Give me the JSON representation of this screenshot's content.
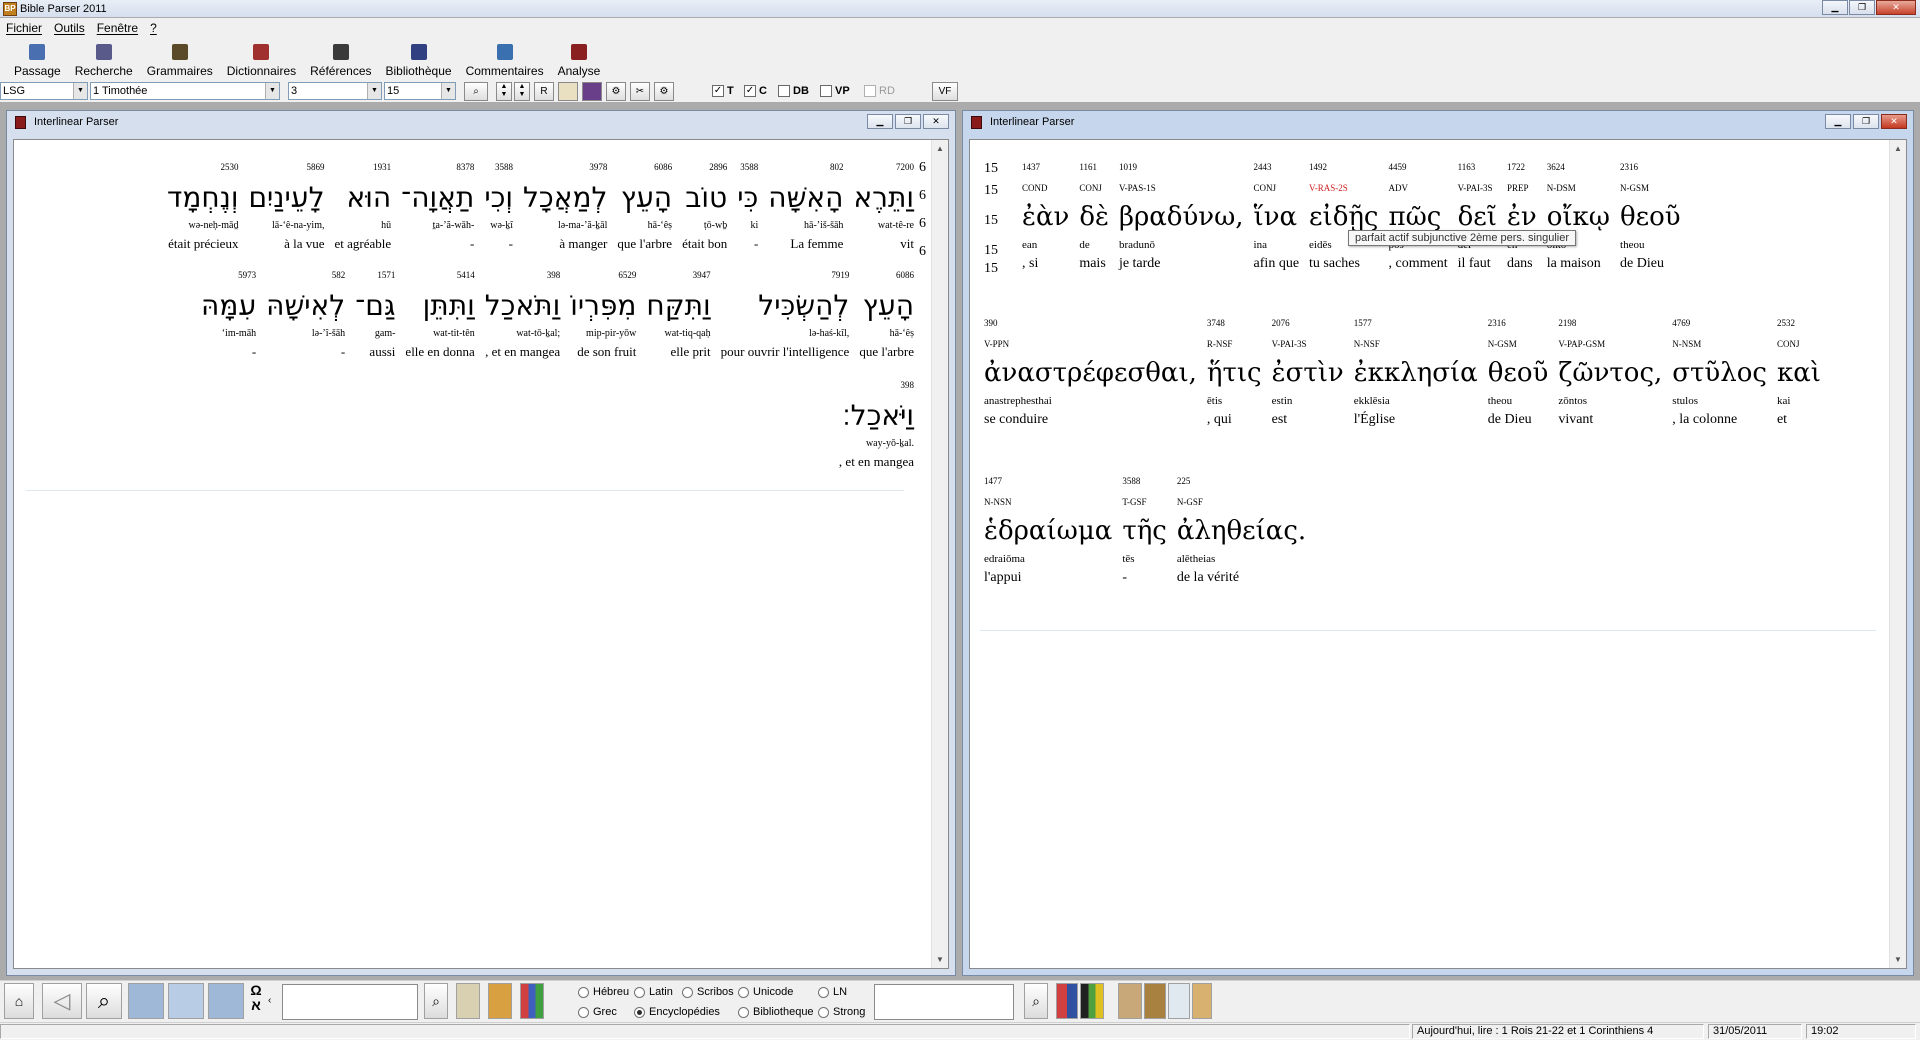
{
  "app": {
    "title": "Bible Parser 2011",
    "icon": "BP"
  },
  "menu": [
    "Fichier",
    "Outils",
    "Fenêtre",
    "?"
  ],
  "toolbar": [
    {
      "label": "Passage",
      "icon": "passage-icon",
      "color": "#4a6fb0"
    },
    {
      "label": "Recherche",
      "icon": "search-icon",
      "color": "#5a5a8a"
    },
    {
      "label": "Grammaires",
      "icon": "grammar-books-icon",
      "color": "#5a4a2a"
    },
    {
      "label": "Dictionnaires",
      "icon": "dictionary-icon",
      "color": "#a03030"
    },
    {
      "label": "Références",
      "icon": "references-icon",
      "color": "#3a3a3a"
    },
    {
      "label": "Bibliothèque",
      "icon": "library-icon",
      "color": "#304080"
    },
    {
      "label": "Commentaires",
      "icon": "comments-icon",
      "color": "#3a70b0"
    },
    {
      "label": "Analyse",
      "icon": "analysis-icon",
      "color": "#8a2020"
    }
  ],
  "selectors": {
    "version": "LSG",
    "book": "1 Timothée",
    "chapter": "3",
    "verse": "15"
  },
  "selbtn": {
    "r": "R",
    "vf": "VF"
  },
  "checks": [
    {
      "label": "T",
      "checked": true
    },
    {
      "label": "C",
      "checked": true
    },
    {
      "label": "DB",
      "checked": false
    },
    {
      "label": "VP",
      "checked": false
    },
    {
      "label": "RD",
      "checked": false,
      "disabled": true
    }
  ],
  "left_window": {
    "title": "Interlinear Parser",
    "verse_nums": [
      "6",
      "6",
      "6",
      "6"
    ],
    "rows": [
      [
        {
          "num": "7200",
          "word": "וַתֵּרֶא",
          "tr": "wat-tê-re",
          "fr": "vit"
        },
        {
          "num": "802",
          "word": "הָאִשָּׁה",
          "tr": "hā-’iš-šāh",
          "fr": "La femme"
        },
        {
          "num": "3588",
          "word": "כִּי",
          "tr": "ki",
          "fr": "-"
        },
        {
          "num": "2896",
          "word": "טוֹב",
          "tr": "ṭō-wḇ",
          "fr": "était bon"
        },
        {
          "num": "6086",
          "word": "הָעֵץ",
          "tr": "hā-‘êṣ",
          "fr": "que l'arbre"
        },
        {
          "num": "3978",
          "word": "לְמַאֲכָל",
          "tr": "lə-ma-’ă-ḵāl",
          "fr": "à manger"
        },
        {
          "num": "3588",
          "word": "וְכִי",
          "tr": "wə-ḵî",
          "fr": "-"
        },
        {
          "num": "8378",
          "word": "תַאֲוָה־",
          "tr": "ṯa-’ă-wāh-",
          "fr": "-"
        },
        {
          "num": "1931",
          "word": "הוּא",
          "tr": "hū",
          "fr": "et agréable"
        },
        {
          "num": "5869",
          "word": "לָעֵינַיִם",
          "tr": "lā-‘ê-na-yim,",
          "fr": "à la vue"
        },
        {
          "num": "2530",
          "word": "וְנֶחְמָד",
          "tr": "wə-neḥ-māḏ",
          "fr": "était précieux"
        }
      ],
      [
        {
          "num": "6086",
          "word": "הָעֵץ",
          "tr": "hā-‘êṣ",
          "fr": "que l'arbre"
        },
        {
          "num": "7919",
          "word": "לְהַשְׂכִּיל",
          "tr": "lə-haś-kîl,",
          "fr": "pour ouvrir l'intelligence"
        },
        {
          "num": "3947",
          "word": "וַתִּקַּח",
          "tr": "wat-tiq-qaḥ",
          "fr": "elle prit"
        },
        {
          "num": "6529",
          "word": "מִפִּרְיוֹ",
          "tr": "mip-pir-yōw",
          "fr": "de son fruit"
        },
        {
          "num": "398",
          "word": "וַתֹּאכַל",
          "tr": "wat-tō-ḵal;",
          "fr": ", et en mangea"
        },
        {
          "num": "5414",
          "word": "וַתִּתֵּן",
          "tr": "wat-tit-tên",
          "fr": "elle en donna"
        },
        {
          "num": "1571",
          "word": "גַּם־",
          "tr": "gam-",
          "fr": "aussi"
        },
        {
          "num": "582",
          "word": "לְאִישָׁהּ",
          "tr": "lə-’î-šāh",
          "fr": "-"
        },
        {
          "num": "5973",
          "word": "עִמָּהּ",
          "tr": "‘im-māh",
          "fr": "-"
        }
      ],
      [
        {
          "num": "398",
          "word": "וַיֹּאכַל׃",
          "tr": "way-yō-ḵal.",
          "fr": ", et en mangea"
        }
      ]
    ]
  },
  "right_window": {
    "title": "Interlinear Parser",
    "verse_nums": [
      "15",
      "15",
      "15",
      "15",
      "15"
    ],
    "rows": [
      [
        {
          "num": "1437",
          "morph": "COND",
          "word": "ἐὰν",
          "tr": "ean",
          "fr": ", si"
        },
        {
          "num": "1161",
          "morph": "CONJ",
          "word": "δὲ",
          "tr": "de",
          "fr": "mais"
        },
        {
          "num": "1019",
          "morph": "V-PAS-1S",
          "word": "βραδύνω,",
          "tr": "bradunō",
          "fr": "je tarde"
        },
        {
          "num": "2443",
          "morph": "CONJ",
          "word": "ἵνα",
          "tr": "ina",
          "fr": "afin que"
        },
        {
          "num": "1492",
          "morph": "V-RAS-2S",
          "word": "εἰδῇς",
          "tr": "eidēs",
          "fr": "tu saches",
          "red": true
        },
        {
          "num": "4459",
          "morph": "ADV",
          "word": "πῶς",
          "tr": "pōs",
          "fr": ", comment"
        },
        {
          "num": "1163",
          "morph": "V-PAI-3S",
          "word": "δεῖ",
          "tr": "dei",
          "fr": "il faut"
        },
        {
          "num": "1722",
          "morph": "PREP",
          "word": "ἐν",
          "tr": "en",
          "fr": "dans"
        },
        {
          "num": "3624",
          "morph": "N-DSM",
          "word": "οἴκῳ",
          "tr": "oikō",
          "fr": "la maison"
        },
        {
          "num": "2316",
          "morph": "N-GSM",
          "word": "θεοῦ",
          "tr": "theou",
          "fr": "de Dieu"
        }
      ],
      [
        {
          "num": "390",
          "morph": "V-PPN",
          "word": "ἀναστρέφεσθαι,",
          "tr": "anastrephesthai",
          "fr": "se conduire"
        },
        {
          "num": "3748",
          "morph": "R-NSF",
          "word": "ἥτις",
          "tr": "ētis",
          "fr": ", qui"
        },
        {
          "num": "2076",
          "morph": "V-PAI-3S",
          "word": "ἐστὶν",
          "tr": "estin",
          "fr": "est"
        },
        {
          "num": "1577",
          "morph": "N-NSF",
          "word": "ἐκκλησία",
          "tr": "ekklēsia",
          "fr": "l'Église"
        },
        {
          "num": "2316",
          "morph": "N-GSM",
          "word": "θεοῦ",
          "tr": "theou",
          "fr": "de Dieu"
        },
        {
          "num": "2198",
          "morph": "V-PAP-GSM",
          "word": "ζῶντος,",
          "tr": "zōntos",
          "fr": "vivant"
        },
        {
          "num": "4769",
          "morph": "N-NSM",
          "word": "στῦλος",
          "tr": "stulos",
          "fr": ", la colonne"
        },
        {
          "num": "2532",
          "morph": "CONJ",
          "word": "καὶ",
          "tr": "kai",
          "fr": "et"
        }
      ],
      [
        {
          "num": "1477",
          "morph": "N-NSN",
          "word": "ἑδραίωμα",
          "tr": "edraiōma",
          "fr": "l'appui"
        },
        {
          "num": "3588",
          "morph": "T-GSF",
          "word": "τῆς",
          "tr": "tēs",
          "fr": "-"
        },
        {
          "num": "225",
          "morph": "N-GSF",
          "word": "ἀληθείας.",
          "tr": "alētheias",
          "fr": "de la vérité"
        }
      ]
    ],
    "tooltip": "parfait actif subjunctive 2ème pers. singulier"
  },
  "bottom": {
    "radios": [
      {
        "label": "Hébreu",
        "on": false
      },
      {
        "label": "Latin",
        "on": false
      },
      {
        "label": "Scribos",
        "on": false
      },
      {
        "label": "Unicode",
        "on": false
      },
      {
        "label": "LN",
        "on": false
      },
      {
        "label": "Grec",
        "on": false
      },
      {
        "label": "Encyclopédies",
        "on": true
      },
      {
        "label": "Bibliotheque",
        "on": false
      },
      {
        "label": "Strong",
        "on": false
      }
    ],
    "omega": "Ω",
    "aleph": "א"
  },
  "status": {
    "reading": "Aujourd'hui, lire : 1 Rois 21-22 et 1 Corinthiens 4",
    "date": "31/05/2011",
    "time": "19:02"
  }
}
